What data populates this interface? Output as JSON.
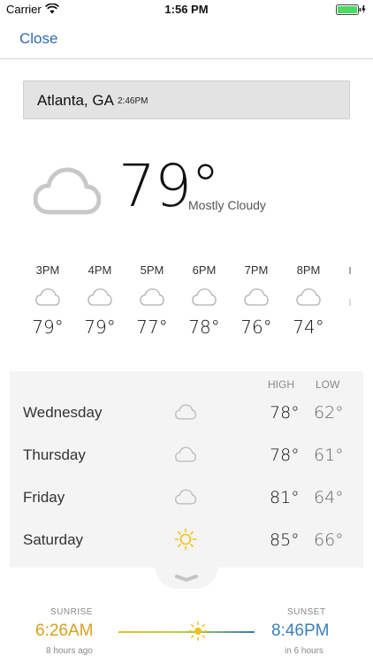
{
  "status_bar": {
    "carrier": "Carrier",
    "time": "1:56 PM"
  },
  "nav": {
    "close_label": "Close"
  },
  "location": {
    "name": "Atlanta, GA",
    "time": "2:46PM"
  },
  "current": {
    "temp": "79°",
    "condition": "Mostly Cloudy",
    "icon": "cloud-icon"
  },
  "hourly": [
    {
      "time": "3PM",
      "icon": "cloud-icon",
      "temp": "79°"
    },
    {
      "time": "4PM",
      "icon": "cloud-icon",
      "temp": "79°"
    },
    {
      "time": "5PM",
      "icon": "cloud-icon",
      "temp": "77°"
    },
    {
      "time": "6PM",
      "icon": "cloud-icon",
      "temp": "78°"
    },
    {
      "time": "7PM",
      "icon": "cloud-icon",
      "temp": "76°"
    },
    {
      "time": "8PM",
      "icon": "cloud-icon",
      "temp": "74°"
    }
  ],
  "forecast": {
    "high_label": "HIGH",
    "low_label": "LOW",
    "days": [
      {
        "day": "Wednesday",
        "icon": "cloud-icon",
        "high": "78°",
        "low": "62°"
      },
      {
        "day": "Thursday",
        "icon": "cloud-icon",
        "high": "78°",
        "low": "61°"
      },
      {
        "day": "Friday",
        "icon": "cloud-icon",
        "high": "81°",
        "low": "64°"
      },
      {
        "day": "Saturday",
        "icon": "sun-icon",
        "high": "85°",
        "low": "66°"
      }
    ]
  },
  "sun": {
    "sunrise_label": "SUNRISE",
    "sunrise_time": "6:26AM",
    "sunrise_relative": "8 hours ago",
    "sunset_label": "SUNSET",
    "sunset_time": "8:46PM",
    "sunset_relative": "in 6 hours",
    "sunrise_color": "#d6a21c",
    "sunset_color": "#3b7fb8"
  }
}
